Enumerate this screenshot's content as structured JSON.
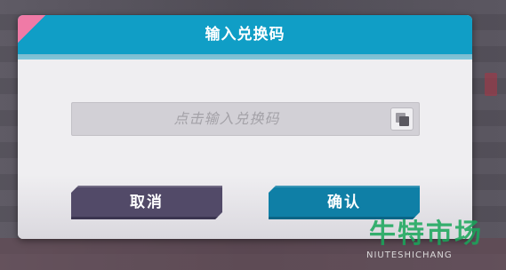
{
  "dialog": {
    "title": "输入兑换码",
    "input": {
      "placeholder": "点击输入兑换码",
      "paste_icon": "paste-icon"
    },
    "buttons": {
      "cancel": "取消",
      "confirm": "确认"
    },
    "colors": {
      "header": "#109ec6",
      "accent": "#f07aa6",
      "cancel": "#524a68",
      "confirm": "#0f7fa6"
    }
  },
  "watermark": {
    "text": "牛特市场",
    "subtext": "NIUTESHICHANG"
  }
}
